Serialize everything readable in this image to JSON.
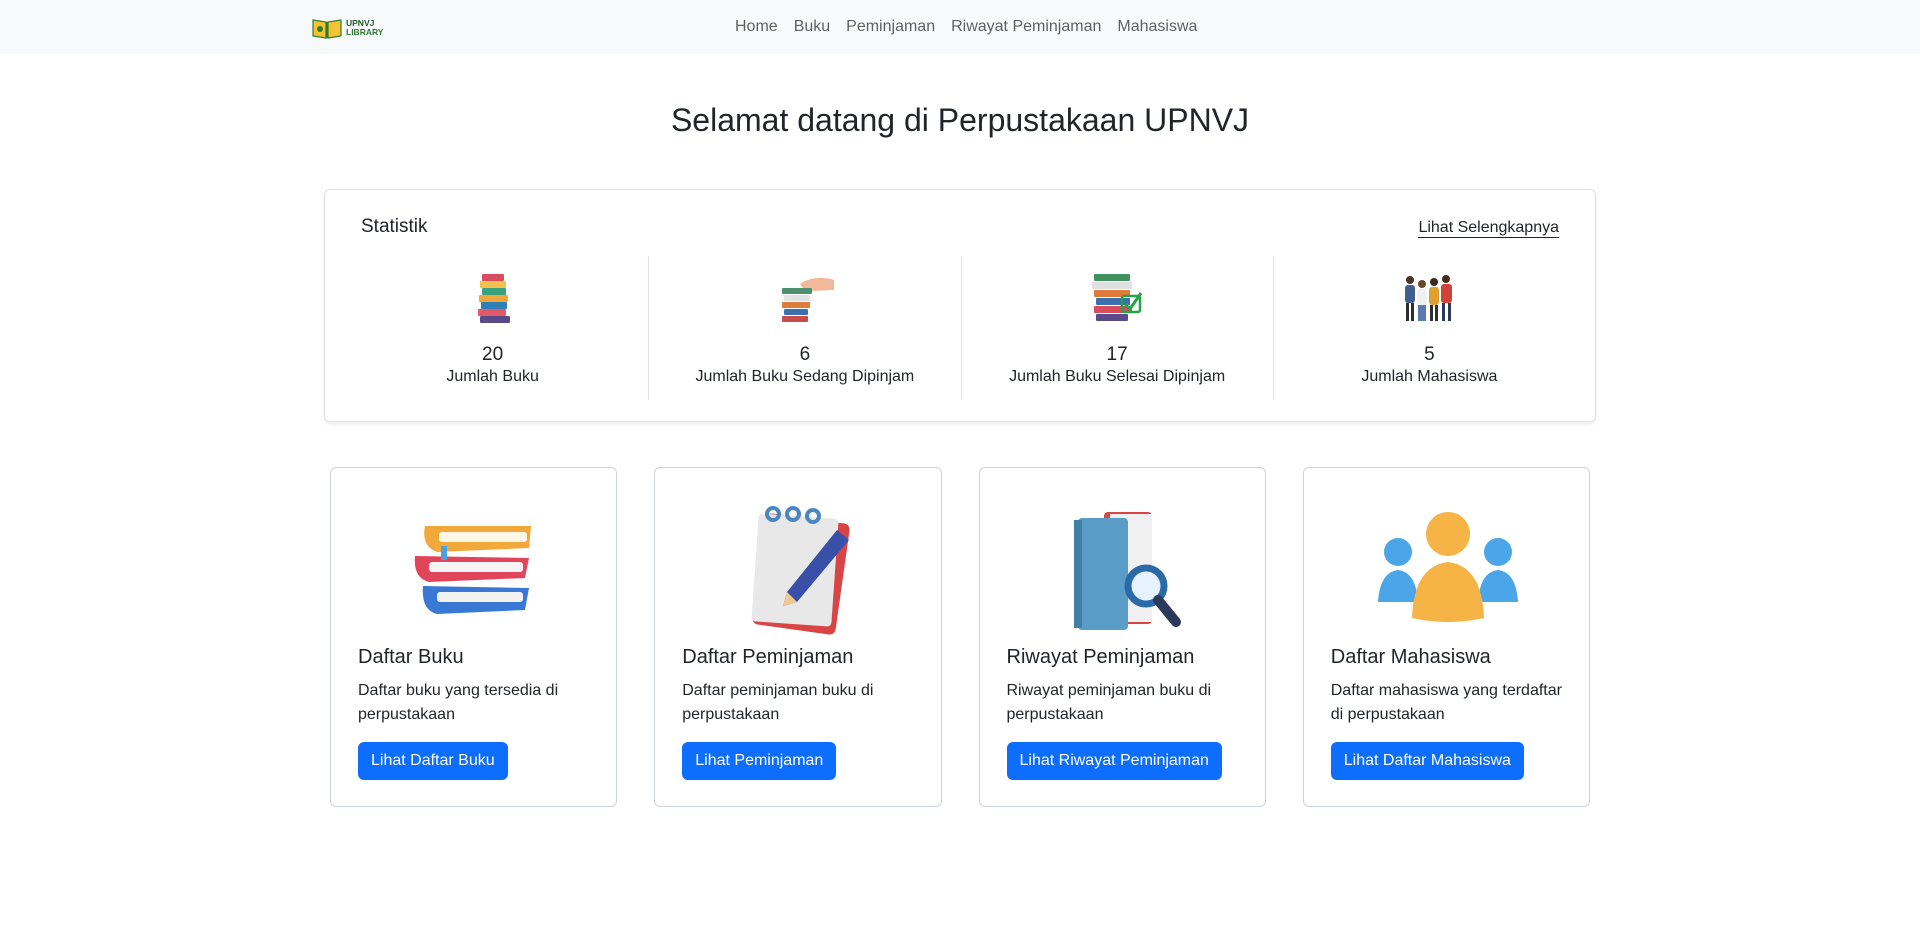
{
  "brand": {
    "line1": "UPNVJ",
    "line2": "LIBRARY"
  },
  "nav": {
    "items": [
      "Home",
      "Buku",
      "Peminjaman",
      "Riwayat Peminjaman",
      "Mahasiswa"
    ]
  },
  "title": "Selamat datang di Perpustakaan UPNVJ",
  "stats": {
    "title": "Statistik",
    "more_link": "Lihat Selengkapnya",
    "items": [
      {
        "value": "20",
        "label": "Jumlah Buku",
        "icon": "book-stack-icon"
      },
      {
        "value": "6",
        "label": "Jumlah Buku Sedang Dipinjam",
        "icon": "book-handover-icon"
      },
      {
        "value": "17",
        "label": "Jumlah Buku Selesai Dipinjam",
        "icon": "books-checked-icon"
      },
      {
        "value": "5",
        "label": "Jumlah Mahasiswa",
        "icon": "students-group-icon"
      }
    ]
  },
  "cards": [
    {
      "title": "Daftar Buku",
      "text": "Daftar buku yang tersedia di perpustakaan",
      "button": "Lihat Daftar Buku",
      "icon": "books-icon"
    },
    {
      "title": "Daftar Peminjaman",
      "text": "Daftar peminjaman buku di perpustakaan",
      "button": "Lihat Peminjaman",
      "icon": "notepad-pencil-icon"
    },
    {
      "title": "Riwayat Peminjaman",
      "text": "Riwayat peminjaman buku di perpustakaan",
      "button": "Lihat Riwayat Peminjaman",
      "icon": "book-search-icon"
    },
    {
      "title": "Daftar Mahasiswa",
      "text": "Daftar mahasiswa yang terdaftar di perpustakaan",
      "button": "Lihat Daftar Mahasiswa",
      "icon": "users-icon"
    }
  ],
  "colors": {
    "primary": "#0d6efd",
    "navbar_bg": "#f8f9fa",
    "border": "#dee2e6"
  }
}
